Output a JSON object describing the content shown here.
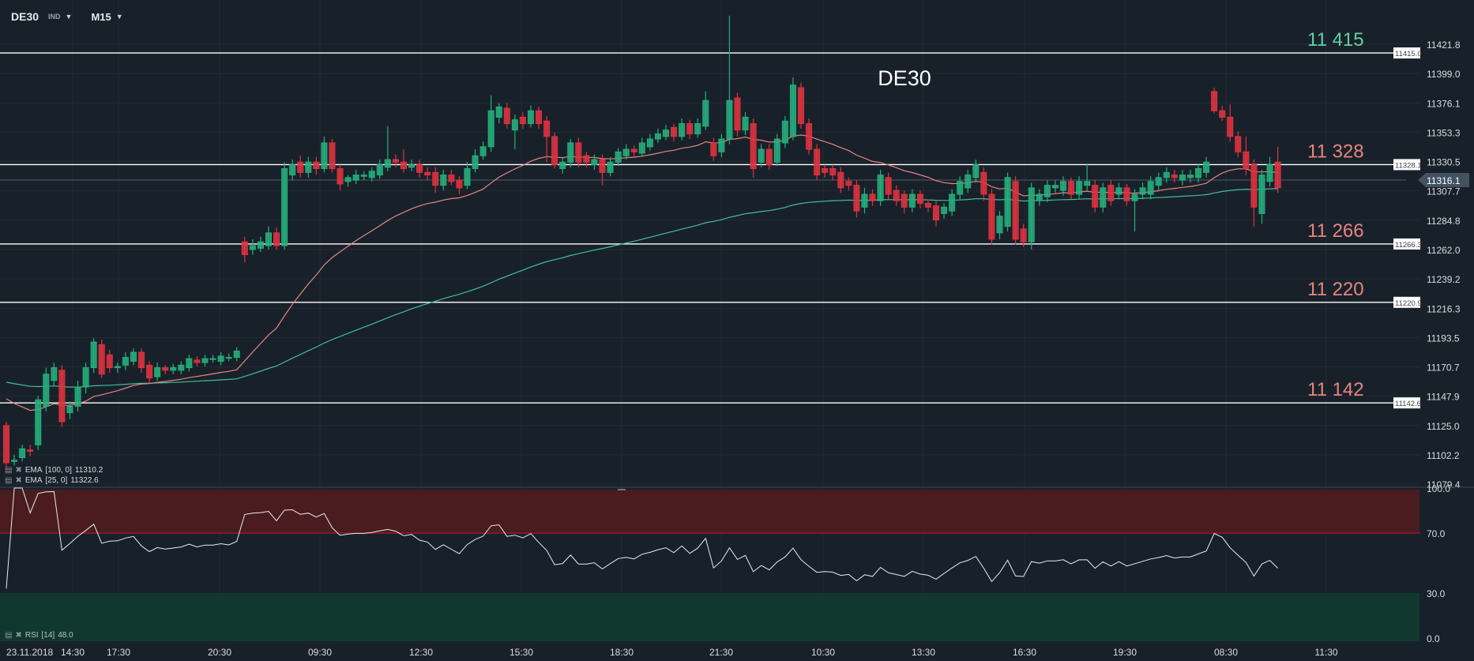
{
  "header": {
    "symbol": "DE30",
    "instrument_type": "IND",
    "timeframe": "M15"
  },
  "indicators": {
    "ema100": {
      "label": "EMA",
      "params": "[100, 0]",
      "value": "11310.2",
      "color": "#3fbf9a"
    },
    "ema25": {
      "label": "EMA",
      "params": "[25, 0]",
      "value": "11322.6",
      "color": "#e8847f"
    },
    "rsi": {
      "label": "RSI",
      "params": "[14]",
      "value": "48.0"
    }
  },
  "colors": {
    "up": "#26b07e",
    "down": "#e0323f",
    "level_line": "#ffffff",
    "level_up_text": "#5fd0a6",
    "level_down_text": "#e8847f",
    "bg": "#18212a",
    "grid": "#222c35",
    "rsi_overbought": "#4a1c1f",
    "rsi_oversold": "#11382f"
  },
  "chart_data": {
    "type": "candlestick",
    "title": "DE30",
    "price_axis": {
      "range": [
        11079.4,
        11421.8
      ],
      "ticks": [
        "11421.8",
        "11399.0",
        "11376.1",
        "11353.3",
        "11330.5",
        "11307.7",
        "11284.8",
        "11262.0",
        "11239.2",
        "11216.3",
        "11193.5",
        "11170.7",
        "11147.9",
        "11125.0",
        "11102.2",
        "11079.4"
      ]
    },
    "current_price": "11316.1",
    "time_axis": {
      "date_label": "23.11.2018",
      "ticks": [
        "14:30",
        "17:30",
        "20:30",
        "09:30",
        "12:30",
        "15:30",
        "18:30",
        "21:30",
        "10:30",
        "13:30",
        "16:30",
        "19:30",
        "08:30",
        "11:30"
      ]
    },
    "levels": [
      {
        "value": 11415.0,
        "tag": "11415.0",
        "label": "11 415",
        "kind": "up"
      },
      {
        "value": 11328.1,
        "tag": "11328.1",
        "label": "11 328",
        "kind": "down"
      },
      {
        "value": 11266.3,
        "tag": "11266.3",
        "label": "11 266",
        "kind": "down"
      },
      {
        "value": 11220.9,
        "tag": "11220.9",
        "label": "11 220",
        "kind": "down"
      },
      {
        "value": 11142.6,
        "tag": "11142.6",
        "label": "11 142",
        "kind": "down"
      }
    ],
    "ema_seed": {
      "ema25": 11150,
      "ema100": 11160
    },
    "rsi_axis": {
      "range": [
        0,
        100
      ],
      "ticks": [
        "100.0",
        "70.0",
        "30.0",
        "0.0"
      ],
      "overbought": 70,
      "oversold": 30
    },
    "candles": [
      [
        11125,
        11128,
        11092,
        11096
      ],
      [
        11097,
        11102,
        11094,
        11098
      ],
      [
        11100,
        11110,
        11097,
        11107
      ],
      [
        11106,
        11110,
        11101,
        11105
      ],
      [
        11110,
        11148,
        11106,
        11145
      ],
      [
        11140,
        11170,
        11136,
        11165
      ],
      [
        11160,
        11174,
        11156,
        11170
      ],
      [
        11168,
        11172,
        11124,
        11128
      ],
      [
        11135,
        11144,
        11130,
        11140
      ],
      [
        11140,
        11160,
        11136,
        11155
      ],
      [
        11155,
        11174,
        11150,
        11170
      ],
      [
        11170,
        11193,
        11166,
        11190
      ],
      [
        11188,
        11192,
        11162,
        11165
      ],
      [
        11180,
        11184,
        11166,
        11170
      ],
      [
        11170,
        11174,
        11166,
        11171
      ],
      [
        11172,
        11182,
        11168,
        11178
      ],
      [
        11175,
        11185,
        11172,
        11182
      ],
      [
        11182,
        11185,
        11166,
        11170
      ],
      [
        11172,
        11175,
        11158,
        11162
      ],
      [
        11163,
        11174,
        11160,
        11170
      ],
      [
        11170,
        11172,
        11165,
        11168
      ],
      [
        11168,
        11173,
        11165,
        11170
      ],
      [
        11168,
        11175,
        11165,
        11172
      ],
      [
        11170,
        11180,
        11167,
        11177
      ],
      [
        11176,
        11179,
        11171,
        11174
      ],
      [
        11174,
        11180,
        11171,
        11177
      ],
      [
        11177,
        11180,
        11174,
        11177
      ],
      [
        11175,
        11182,
        11172,
        11179
      ],
      [
        11178,
        11181,
        11175,
        11178
      ],
      [
        11178,
        11186,
        11175,
        11183
      ],
      [
        11268,
        11272,
        11252,
        11258
      ],
      [
        11262,
        11270,
        11258,
        11265
      ],
      [
        11263,
        11272,
        11260,
        11268
      ],
      [
        11265,
        11280,
        11262,
        11275
      ],
      [
        11275,
        11279,
        11262,
        11265
      ],
      [
        11265,
        11330,
        11262,
        11325
      ],
      [
        11320,
        11332,
        11316,
        11328
      ],
      [
        11330,
        11335,
        11318,
        11322
      ],
      [
        11322,
        11334,
        11318,
        11330
      ],
      [
        11330,
        11334,
        11320,
        11325
      ],
      [
        11325,
        11350,
        11322,
        11345
      ],
      [
        11345,
        11348,
        11322,
        11325
      ],
      [
        11325,
        11328,
        11308,
        11313
      ],
      [
        11315,
        11320,
        11311,
        11318
      ],
      [
        11316,
        11324,
        11313,
        11320
      ],
      [
        11319,
        11323,
        11316,
        11320
      ],
      [
        11318,
        11326,
        11315,
        11323
      ],
      [
        11320,
        11332,
        11317,
        11328
      ],
      [
        11326,
        11358,
        11323,
        11332
      ],
      [
        11332,
        11336,
        11326,
        11330
      ],
      [
        11330,
        11340,
        11322,
        11325
      ],
      [
        11326,
        11332,
        11323,
        11328
      ],
      [
        11328,
        11332,
        11318,
        11322
      ],
      [
        11322,
        11326,
        11316,
        11320
      ],
      [
        11322,
        11326,
        11306,
        11312
      ],
      [
        11312,
        11324,
        11308,
        11320
      ],
      [
        11320,
        11324,
        11312,
        11315
      ],
      [
        11316,
        11319,
        11305,
        11310
      ],
      [
        11312,
        11330,
        11309,
        11325
      ],
      [
        11325,
        11340,
        11322,
        11335
      ],
      [
        11335,
        11346,
        11332,
        11342
      ],
      [
        11342,
        11382,
        11338,
        11370
      ],
      [
        11365,
        11376,
        11360,
        11373
      ],
      [
        11372,
        11376,
        11356,
        11360
      ],
      [
        11355,
        11367,
        11340,
        11363
      ],
      [
        11365,
        11369,
        11356,
        11360
      ],
      [
        11360,
        11374,
        11357,
        11370
      ],
      [
        11370,
        11373,
        11356,
        11360
      ],
      [
        11362,
        11366,
        11330,
        11350
      ],
      [
        11350,
        11353,
        11325,
        11328
      ],
      [
        11325,
        11334,
        11321,
        11330
      ],
      [
        11330,
        11348,
        11326,
        11345
      ],
      [
        11345,
        11349,
        11326,
        11330
      ],
      [
        11335,
        11338,
        11326,
        11330
      ],
      [
        11328,
        11336,
        11324,
        11332
      ],
      [
        11332,
        11336,
        11312,
        11322
      ],
      [
        11322,
        11334,
        11319,
        11330
      ],
      [
        11330,
        11341,
        11327,
        11338
      ],
      [
        11335,
        11344,
        11332,
        11340
      ],
      [
        11340,
        11343,
        11334,
        11338
      ],
      [
        11337,
        11349,
        11334,
        11345
      ],
      [
        11342,
        11352,
        11339,
        11348
      ],
      [
        11348,
        11356,
        11345,
        11352
      ],
      [
        11350,
        11359,
        11347,
        11355
      ],
      [
        11357,
        11360,
        11346,
        11350
      ],
      [
        11350,
        11364,
        11347,
        11360
      ],
      [
        11360,
        11363,
        11348,
        11352
      ],
      [
        11352,
        11364,
        11349,
        11360
      ],
      [
        11358,
        11385,
        11355,
        11378
      ],
      [
        11345,
        11349,
        11331,
        11335
      ],
      [
        11338,
        11352,
        11334,
        11348
      ],
      [
        11348,
        11444,
        11344,
        11378
      ],
      [
        11380,
        11384,
        11350,
        11355
      ],
      [
        11355,
        11369,
        11351,
        11365
      ],
      [
        11360,
        11364,
        11318,
        11325
      ],
      [
        11330,
        11344,
        11326,
        11340
      ],
      [
        11340,
        11344,
        11324,
        11328
      ],
      [
        11330,
        11352,
        11327,
        11348
      ],
      [
        11345,
        11366,
        11341,
        11362
      ],
      [
        11350,
        11396,
        11347,
        11390
      ],
      [
        11388,
        11392,
        11356,
        11360
      ],
      [
        11360,
        11364,
        11336,
        11340
      ],
      [
        11340,
        11344,
        11316,
        11320
      ],
      [
        11325,
        11328,
        11318,
        11322
      ],
      [
        11325,
        11328,
        11316,
        11320
      ],
      [
        11322,
        11326,
        11306,
        11310
      ],
      [
        11315,
        11318,
        11308,
        11312
      ],
      [
        11312,
        11316,
        11287,
        11292
      ],
      [
        11295,
        11310,
        11290,
        11305
      ],
      [
        11305,
        11309,
        11296,
        11300
      ],
      [
        11300,
        11324,
        11296,
        11320
      ],
      [
        11318,
        11322,
        11301,
        11305
      ],
      [
        11308,
        11312,
        11296,
        11300
      ],
      [
        11305,
        11308,
        11290,
        11295
      ],
      [
        11295,
        11309,
        11291,
        11305
      ],
      [
        11305,
        11308,
        11294,
        11298
      ],
      [
        11298,
        11301,
        11291,
        11295
      ],
      [
        11296,
        11300,
        11280,
        11285
      ],
      [
        11290,
        11298,
        11286,
        11295
      ],
      [
        11292,
        11309,
        11288,
        11305
      ],
      [
        11305,
        11319,
        11301,
        11315
      ],
      [
        11310,
        11324,
        11306,
        11320
      ],
      [
        11318,
        11332,
        11314,
        11328
      ],
      [
        11322,
        11326,
        11300,
        11305
      ],
      [
        11305,
        11309,
        11266,
        11270
      ],
      [
        11275,
        11292,
        11270,
        11288
      ],
      [
        11280,
        11322,
        11276,
        11318
      ],
      [
        11315,
        11319,
        11266,
        11270
      ],
      [
        11278,
        11282,
        11264,
        11268
      ],
      [
        11268,
        11314,
        11262,
        11310
      ],
      [
        11300,
        11309,
        11296,
        11305
      ],
      [
        11303,
        11316,
        11299,
        11312
      ],
      [
        11310,
        11316,
        11306,
        11312
      ],
      [
        11308,
        11319,
        11304,
        11315
      ],
      [
        11315,
        11318,
        11301,
        11305
      ],
      [
        11305,
        11319,
        11301,
        11315
      ],
      [
        11312,
        11329,
        11308,
        11315
      ],
      [
        11312,
        11316,
        11291,
        11295
      ],
      [
        11295,
        11314,
        11291,
        11310
      ],
      [
        11312,
        11316,
        11296,
        11300
      ],
      [
        11305,
        11314,
        11301,
        11310
      ],
      [
        11310,
        11313,
        11296,
        11300
      ],
      [
        11300,
        11309,
        11276,
        11305
      ],
      [
        11305,
        11314,
        11301,
        11310
      ],
      [
        11305,
        11319,
        11301,
        11315
      ],
      [
        11312,
        11322,
        11308,
        11318
      ],
      [
        11318,
        11326,
        11314,
        11322
      ],
      [
        11320,
        11324,
        11314,
        11318
      ],
      [
        11316,
        11324,
        11312,
        11320
      ],
      [
        11318,
        11324,
        11314,
        11320
      ],
      [
        11318,
        11329,
        11314,
        11325
      ],
      [
        11322,
        11334,
        11318,
        11330
      ],
      [
        11385,
        11388,
        11368,
        11370
      ],
      [
        11370,
        11374,
        11362,
        11365
      ],
      [
        11365,
        11375,
        11346,
        11350
      ],
      [
        11350,
        11354,
        11334,
        11338
      ],
      [
        11338,
        11350,
        11320,
        11325
      ],
      [
        11328,
        11332,
        11280,
        11295
      ],
      [
        11290,
        11324,
        11282,
        11320
      ],
      [
        11315,
        11334,
        11311,
        11328
      ],
      [
        11330,
        11342,
        11306,
        11310
      ]
    ]
  }
}
